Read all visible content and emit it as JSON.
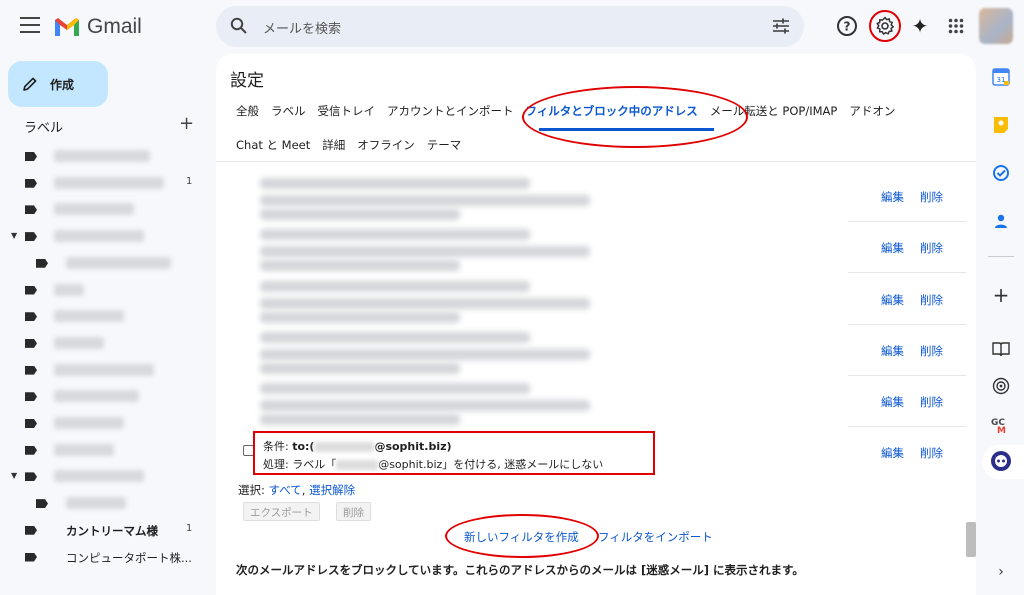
{
  "app": {
    "name": "Gmail"
  },
  "search": {
    "placeholder": "メールを検索"
  },
  "compose": {
    "label": "作成"
  },
  "labels": {
    "title": "ラベル",
    "add": "+",
    "items": [
      {
        "blurred": true,
        "blur_width": 96
      },
      {
        "blurred": true,
        "blur_width": 110,
        "count": "1"
      },
      {
        "blurred": true,
        "blur_width": 80
      },
      {
        "blurred": true,
        "blur_width": 90,
        "expanded": true
      },
      {
        "blurred": true,
        "blur_width": 105,
        "indent": true
      },
      {
        "blurred": true,
        "blur_width": 30
      },
      {
        "blurred": true,
        "blur_width": 70
      },
      {
        "blurred": true,
        "blur_width": 50
      },
      {
        "blurred": true,
        "blur_width": 100
      },
      {
        "blurred": true,
        "blur_width": 85
      },
      {
        "blurred": true,
        "blur_width": 70
      },
      {
        "blurred": true,
        "blur_width": 60
      },
      {
        "blurred": true,
        "blur_width": 90,
        "expanded": true
      },
      {
        "blurred": true,
        "blur_width": 60,
        "indent": true
      },
      {
        "blurred": false,
        "text": "カントリーマム様",
        "count": "1"
      },
      {
        "blurred": false,
        "text": "コンピュータポート株..."
      }
    ]
  },
  "settings": {
    "title": "設定",
    "tabs_row1": [
      "全般",
      "ラベル",
      "受信トレイ",
      "アカウントとインポート",
      "フィルタとブロック中のアドレス",
      "メール転送と POP/IMAP",
      "アドオン"
    ],
    "tabs_row2": [
      "Chat と Meet",
      "詳細",
      "オフライン",
      "テーマ"
    ],
    "active_tab": "フィルタとブロック中のアドレス"
  },
  "filters": {
    "edit_label": "編集",
    "delete_label": "削除",
    "last": {
      "criteria_prefix": "条件: ",
      "criteria_to": "to:(",
      "criteria_domain": "@sophit.biz)",
      "action_prefix": "処理: ラベル「",
      "action_domain": "@sophit.biz」を付ける, 迷惑メールにしない"
    }
  },
  "selection": {
    "label": "選択: ",
    "all": "すべて",
    "comma": ", ",
    "none": "選択解除"
  },
  "buttons": {
    "export": "エクスポート",
    "delete": "削除"
  },
  "links": {
    "new_filter": "新しいフィルタを作成",
    "import_filter": "フィルタをインポート"
  },
  "blocked_note": "次のメールアドレスをブロックしています。これらのアドレスからのメールは [迷惑メール] に表示されます。",
  "colors": {
    "accent": "#0b57d0",
    "annotation": "#e00000",
    "compose_bg": "#c2e7ff"
  }
}
